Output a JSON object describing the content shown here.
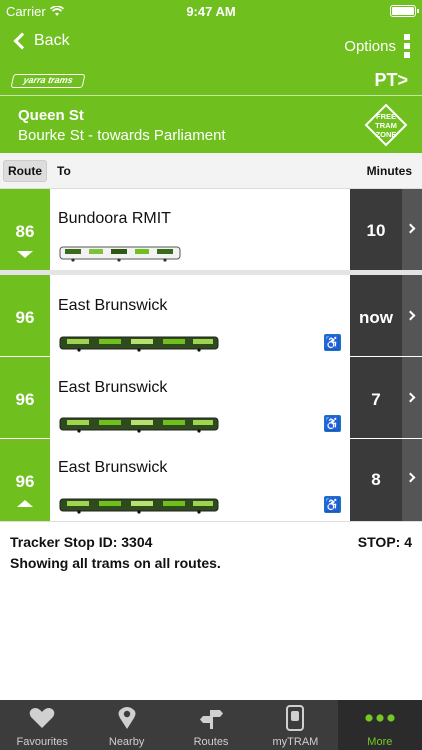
{
  "status": {
    "carrier": "Carrier",
    "time": "9:47 AM"
  },
  "nav": {
    "back_label": "Back",
    "options_label": "Options"
  },
  "brand": {
    "yarra": "yarra trams",
    "pt": "PT>"
  },
  "stop": {
    "name": "Queen St",
    "subtitle": "Bourke St - towards Parliament",
    "zone_lines": [
      "FREE",
      "TRAM",
      "ZONE"
    ]
  },
  "columns": {
    "route": "Route",
    "to": "To",
    "minutes": "Minutes"
  },
  "rows": [
    {
      "route": "86",
      "destination": "Bundoora RMIT",
      "minutes": "10",
      "accessible": false,
      "arrow": "down"
    },
    {
      "route": "96",
      "destination": "East Brunswick",
      "minutes": "now",
      "accessible": true,
      "arrow": ""
    },
    {
      "route": "96",
      "destination": "East Brunswick",
      "minutes": "7",
      "accessible": true,
      "arrow": ""
    },
    {
      "route": "96",
      "destination": "East Brunswick",
      "minutes": "8",
      "accessible": true,
      "arrow": "up"
    }
  ],
  "info": {
    "tracker": "Tracker Stop ID: 3304",
    "stop": "STOP:  4",
    "showing": "Showing all trams on all routes."
  },
  "tabs": [
    {
      "label": "Favourites",
      "icon": "heart-icon",
      "active": false
    },
    {
      "label": "Nearby",
      "icon": "location-pin-icon",
      "active": false
    },
    {
      "label": "Routes",
      "icon": "routes-signpost-icon",
      "active": false
    },
    {
      "label": "myTRAM",
      "icon": "mytram-phone-icon",
      "active": false
    },
    {
      "label": "More",
      "icon": "more-dots-icon",
      "active": true
    }
  ],
  "colors": {
    "green": "#6fbf1f",
    "dark": "#3a3a3a",
    "access_blue": "#1a73c8",
    "tab_active": "#76c726"
  }
}
